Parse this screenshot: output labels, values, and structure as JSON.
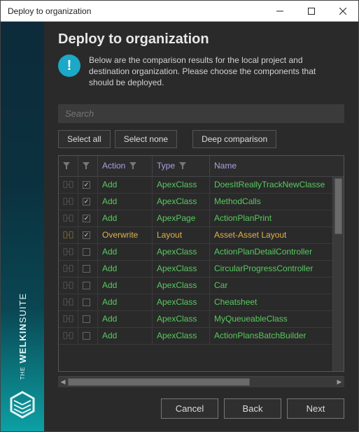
{
  "window": {
    "title": "Deploy to organization"
  },
  "brand": {
    "line1": "THE",
    "line2": "WELKIN",
    "line3": "SUITE"
  },
  "header": {
    "title": "Deploy to organization",
    "intro": "Below are the comparison results for the local project and destination organization. Please choose the components that should be deployed."
  },
  "search": {
    "placeholder": "Search"
  },
  "buttons": {
    "select_all": "Select all",
    "select_none": "Select none",
    "deep_compare": "Deep comparison",
    "cancel": "Cancel",
    "back": "Back",
    "next": "Next"
  },
  "grid": {
    "columns": {
      "action": "Action",
      "type": "Type",
      "name": "Name"
    },
    "rows": [
      {
        "checked": true,
        "action": "Add",
        "type": "ApexClass",
        "name": "DoesItReallyTrackNewClasse"
      },
      {
        "checked": true,
        "action": "Add",
        "type": "ApexClass",
        "name": "MethodCalls"
      },
      {
        "checked": true,
        "action": "Add",
        "type": "ApexPage",
        "name": "ActionPlanPrint"
      },
      {
        "checked": true,
        "action": "Overwrite",
        "type": "Layout",
        "name": "Asset-Asset Layout",
        "highlight": true
      },
      {
        "checked": false,
        "action": "Add",
        "type": "ApexClass",
        "name": "ActionPlanDetailController"
      },
      {
        "checked": false,
        "action": "Add",
        "type": "ApexClass",
        "name": "CircularProgressController"
      },
      {
        "checked": false,
        "action": "Add",
        "type": "ApexClass",
        "name": "Car"
      },
      {
        "checked": false,
        "action": "Add",
        "type": "ApexClass",
        "name": "Cheatsheet"
      },
      {
        "checked": false,
        "action": "Add",
        "type": "ApexClass",
        "name": "MyQueueableClass"
      },
      {
        "checked": false,
        "action": "Add",
        "type": "ApexClass",
        "name": "ActionPlansBatchBuilder"
      }
    ]
  }
}
